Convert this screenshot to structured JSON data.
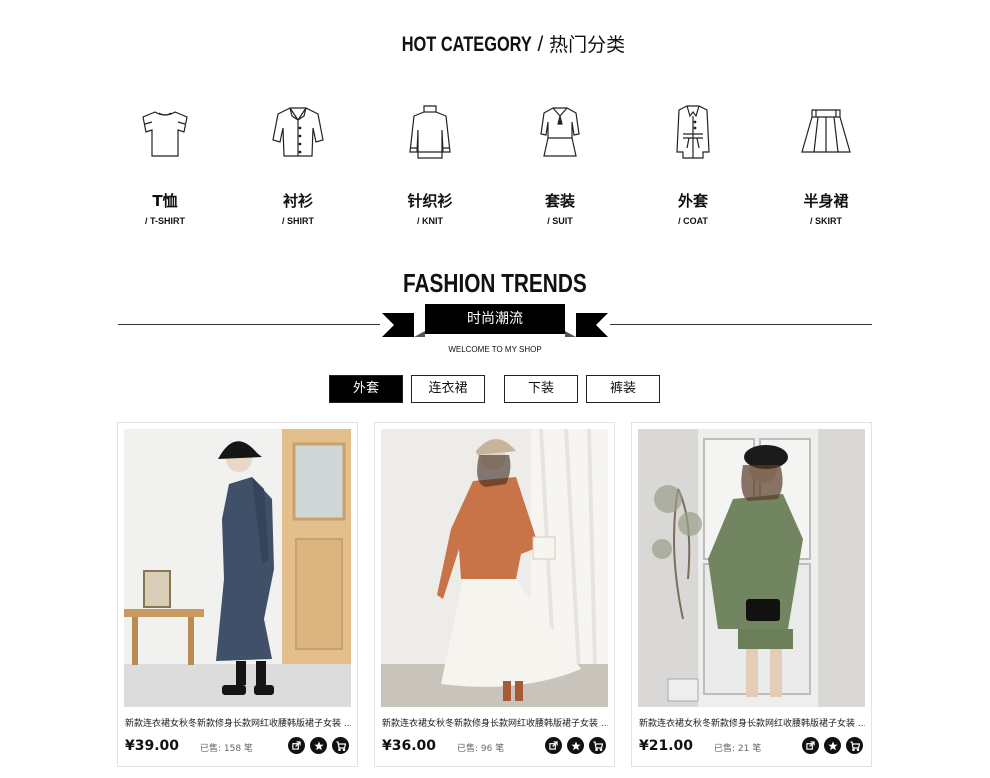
{
  "hot_category": {
    "title_en": "HOT CATEGORY",
    "separator": " / ",
    "title_cn": "热门分类",
    "items": [
      {
        "cn": "T恤",
        "en": "/ T-SHIRT",
        "icon": "tshirt-icon"
      },
      {
        "cn": "衬衫",
        "en": "/ SHIRT",
        "icon": "shirt-icon"
      },
      {
        "cn": "针织衫",
        "en": "/ KNIT",
        "icon": "knit-icon"
      },
      {
        "cn": "套装",
        "en": "/ SUIT",
        "icon": "suit-icon"
      },
      {
        "cn": "外套",
        "en": "/ COAT",
        "icon": "coat-icon"
      },
      {
        "cn": "半身裙",
        "en": "/ SKIRT",
        "icon": "skirt-icon"
      }
    ]
  },
  "fashion_trends": {
    "title": "FASHION TRENDS",
    "ribbon_text": "时尚潮流",
    "subtitle": "WELCOME TO MY SHOP"
  },
  "tabs": [
    {
      "label": "外套",
      "active": true
    },
    {
      "label": "连衣裙",
      "active": false
    },
    {
      "label": "下装",
      "active": false
    },
    {
      "label": "裤装",
      "active": false
    }
  ],
  "products": [
    {
      "title": "新款连衣裙女秋冬新款修身长款网红收腰韩版裙子女装 ...",
      "price": "¥39.00",
      "sold": "已售: 158 笔"
    },
    {
      "title": "新款连衣裙女秋冬新款修身长款网红收腰韩版裙子女装 ...",
      "price": "¥36.00",
      "sold": "已售: 96 笔"
    },
    {
      "title": "新款连衣裙女秋冬新款修身长款网红收腰韩版裙子女装 ...",
      "price": "¥21.00",
      "sold": "已售: 21 笔"
    }
  ],
  "colors": {
    "accent": "#000000",
    "text": "#111111",
    "border": "#e2e2e2"
  }
}
